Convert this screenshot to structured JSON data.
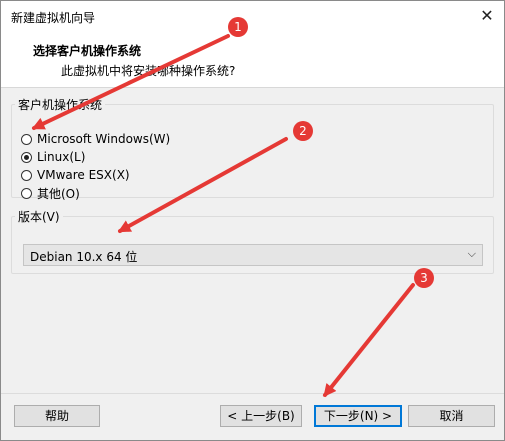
{
  "window": {
    "title": "新建虚拟机向导",
    "close_symbol": "✕"
  },
  "header": {
    "title": "选择客户机操作系统",
    "subtitle": "此虚拟机中将安装哪种操作系统?"
  },
  "os_group": {
    "legend": "客户机操作系统",
    "options": [
      {
        "label": "Microsoft Windows(W)",
        "checked": false
      },
      {
        "label": "Linux(L)",
        "checked": true
      },
      {
        "label": "VMware ESX(X)",
        "checked": false
      },
      {
        "label": "其他(O)",
        "checked": false
      }
    ]
  },
  "version_group": {
    "legend": "版本(V)",
    "selected": "Debian 10.x 64 位",
    "arrow": "⌵"
  },
  "buttons": {
    "help": "帮助",
    "back": "< 上一步(B)",
    "next": "下一步(N) >",
    "cancel": "取消"
  },
  "annotations": {
    "color": "#e53935",
    "badges": [
      "1",
      "2",
      "3"
    ]
  }
}
